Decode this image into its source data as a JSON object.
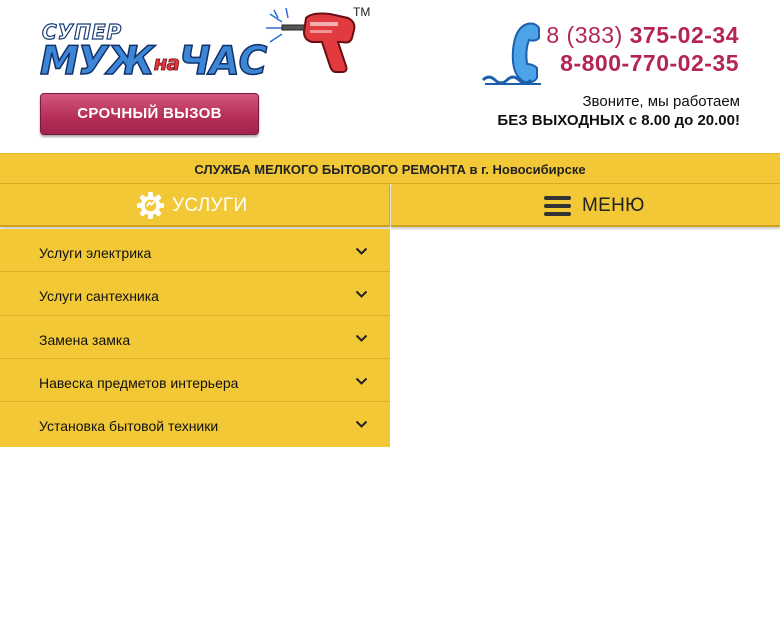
{
  "logo": {
    "super": "СУПЕР",
    "part1": "МУЖ",
    "part2": "на",
    "part3": "ЧАС",
    "tm": "TM"
  },
  "header": {
    "urgent_button": "СРОЧНЫЙ ВЫЗОВ",
    "phone1_code": "8 (383)",
    "phone1_number": "375-02-34",
    "phone2": "8-800-770-02-35",
    "note1": "Звоните, мы работаем",
    "note2": "БЕЗ ВЫХОДНЫХ с 8.00 до 20.00!"
  },
  "tagline": "СЛУЖБА МЕЛКОГО БЫТОВОГО РЕМОНТА в г. Новосибирске",
  "nav": {
    "services_label": "УСЛУГИ",
    "menu_label": "МЕНЮ"
  },
  "services_dropdown": {
    "items": [
      {
        "label": "Услуги электрика"
      },
      {
        "label": "Услуги сантехника"
      },
      {
        "label": "Замена замка"
      },
      {
        "label": "Навеска предметов интерьера"
      },
      {
        "label": "Установка бытовой техники"
      }
    ]
  },
  "colors": {
    "accent_yellow": "#f2c836",
    "brand_magenta": "#b52457",
    "logo_blue": "#3d86d6",
    "drill_red": "#e23b3f"
  },
  "icons": {
    "phone": "phone-handset-icon",
    "gear": "gear-icon",
    "menu": "hamburger-menu-icon",
    "chevron": "chevron-down-icon",
    "drill": "drill-icon"
  }
}
